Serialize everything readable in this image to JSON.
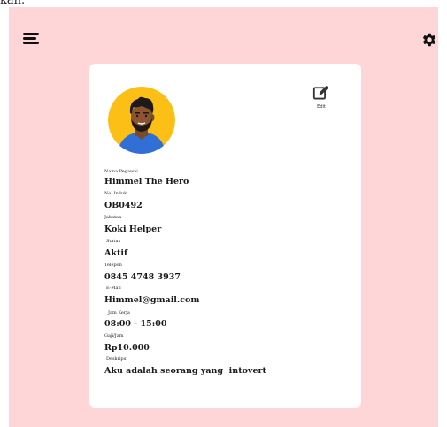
{
  "top_crop_text": "kan.",
  "profile": {
    "edit_label": "Edit",
    "fields": [
      {
        "label": "Nama Pegawai",
        "value": "Himmel The Hero"
      },
      {
        "label": "No. Induk",
        "value": "OB0492"
      },
      {
        "label": "Jabatan",
        "value": "Koki Helper"
      },
      {
        "label": "Status",
        "value": "Aktif"
      },
      {
        "label": "Telepon",
        "value": "0845 4748 3937"
      },
      {
        "label": "E-Mail",
        "value": "Himmel@gmail.com"
      },
      {
        "label": "Jam Kerja",
        "value": "08:00 - 15:00"
      },
      {
        "label": "Gaji/Jam",
        "value": "Rp10.000"
      },
      {
        "label": "Deskripsi",
        "value": "Aku adalah seorang yang  intovert"
      }
    ]
  },
  "colors": {
    "background": "#ffd6d8",
    "card": "#ffffff",
    "avatar_circle": "#fbbf16",
    "shirt": "#2f6fd6",
    "text": "#1a1a1a"
  },
  "icons": {
    "menu": "hamburger-menu-icon",
    "settings": "gear-icon",
    "edit": "edit-icon"
  }
}
